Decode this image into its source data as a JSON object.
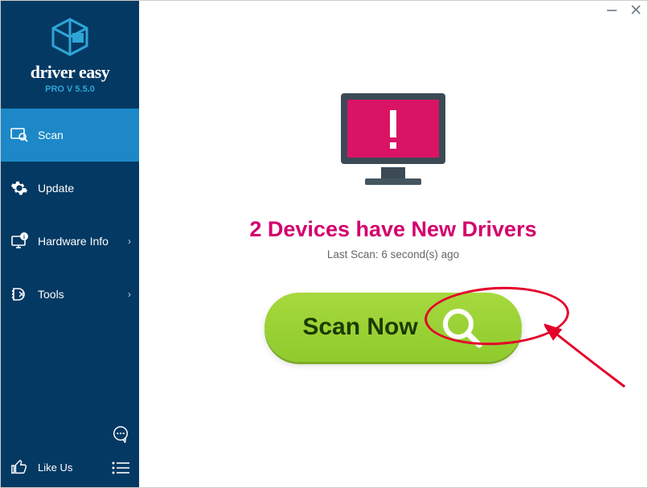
{
  "brand": {
    "name": "driver easy",
    "version": "PRO V 5.5.0"
  },
  "nav": {
    "scan": "Scan",
    "update": "Update",
    "hardware": "Hardware Info",
    "tools": "Tools",
    "likeus": "Like Us"
  },
  "main": {
    "headline": "2 Devices have New Drivers",
    "subline": "Last Scan: 6 second(s) ago",
    "scan_label": "Scan Now"
  },
  "colors": {
    "sidebar": "#043963",
    "sidebar_active": "#1C88C7",
    "accent": "#D3006D",
    "scan_btn": "#9ACF33",
    "annot": "#E3002B"
  }
}
